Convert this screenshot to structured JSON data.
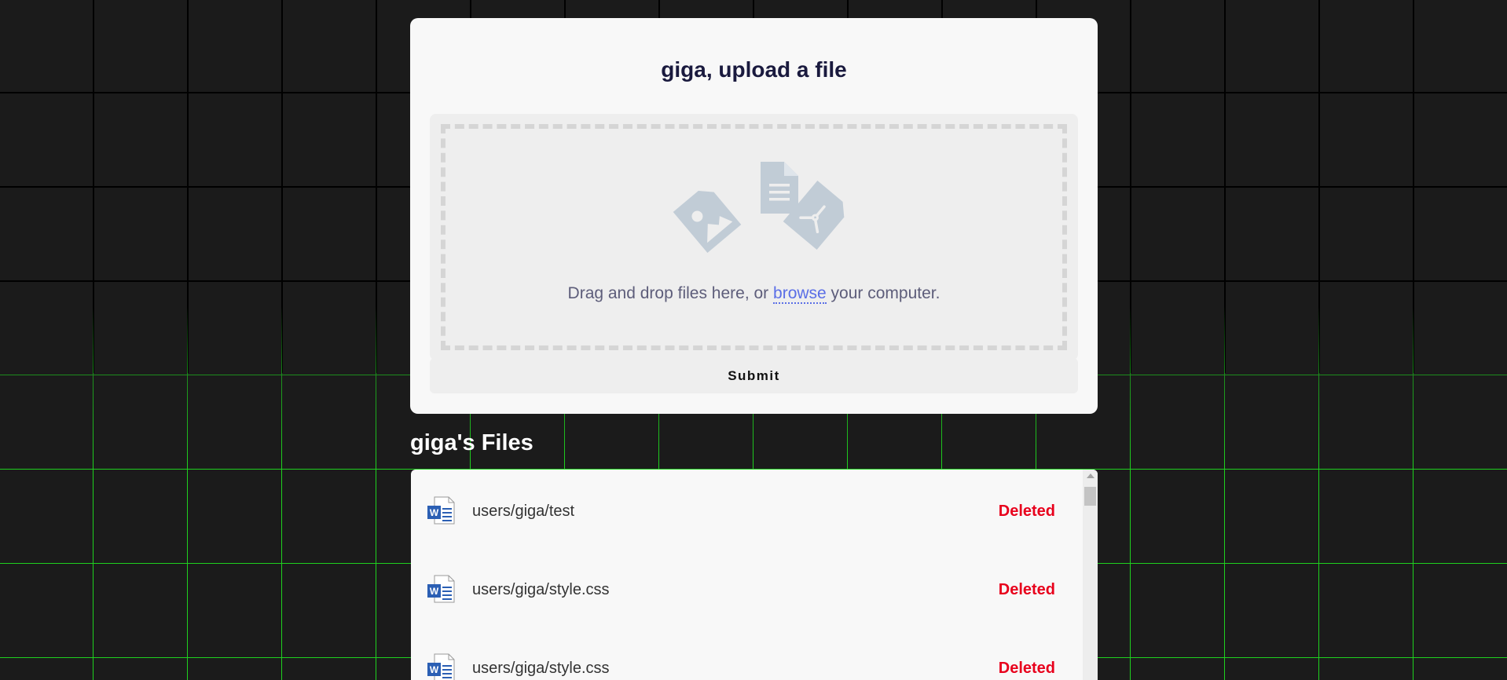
{
  "upload": {
    "title": "giga, upload a file",
    "drop_text_before": "Drag and drop files here, or ",
    "browse_label": "browse",
    "drop_text_after": " your computer.",
    "icons": [
      "image-file-icon",
      "document-file-icon",
      "pdf-file-icon"
    ],
    "submit_label": "Submit"
  },
  "files": {
    "heading": "giga's Files",
    "items": [
      {
        "name": "users/giga/test",
        "status": "Deleted",
        "icon": "word-document-icon"
      },
      {
        "name": "users/giga/style.css",
        "status": "Deleted",
        "icon": "word-document-icon"
      },
      {
        "name": "users/giga/style.css",
        "status": "Deleted",
        "icon": "word-document-icon"
      }
    ]
  },
  "colors": {
    "background": "#1b1b1b",
    "grid_green": "#1fd11f",
    "card": "#f8f8f8",
    "title": "#1a1a3e",
    "link": "#5a6ee6",
    "deleted": "#e8001c",
    "icon_gray": "#c1ccd6",
    "word_blue": "#2b5fb4"
  }
}
